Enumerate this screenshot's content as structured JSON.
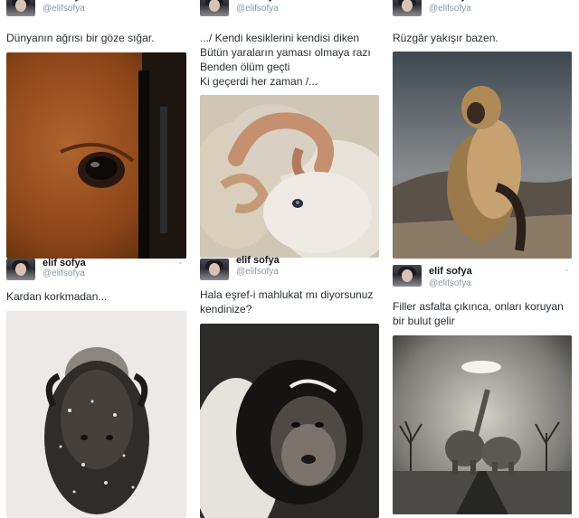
{
  "author": {
    "name": "elif sofya",
    "handle": "@elifsofya"
  },
  "tweets": [
    {
      "text": "Dünyanın ağrısı bir göze sığar.",
      "image": "horse-eye-photo"
    },
    {
      "text": ".../ Kendi kesiklerini kendisi diken\n Bütün yaraların yaması olmaya razı\n Benden ölüm geçti\n Ki geçerdi her zaman /...",
      "image": "ram-photo"
    },
    {
      "text": "Rüzgâr yakışır bazen.",
      "image": "gelada-monkey-photo"
    },
    {
      "text": "Kardan korkmadan...",
      "image": "snowy-bison-photo"
    },
    {
      "text": "Hala eşref-i mahlukat mı diyorsunuz kendinize?",
      "image": "colobus-monkey-photo"
    },
    {
      "text": "Filler asfalta çıkınca, onları koruyan bir bulut gelir",
      "image": "elephants-cloud-photo"
    }
  ],
  "colors": {
    "name": "#14171a",
    "handle": "#8899a6",
    "text": "#292f33"
  }
}
